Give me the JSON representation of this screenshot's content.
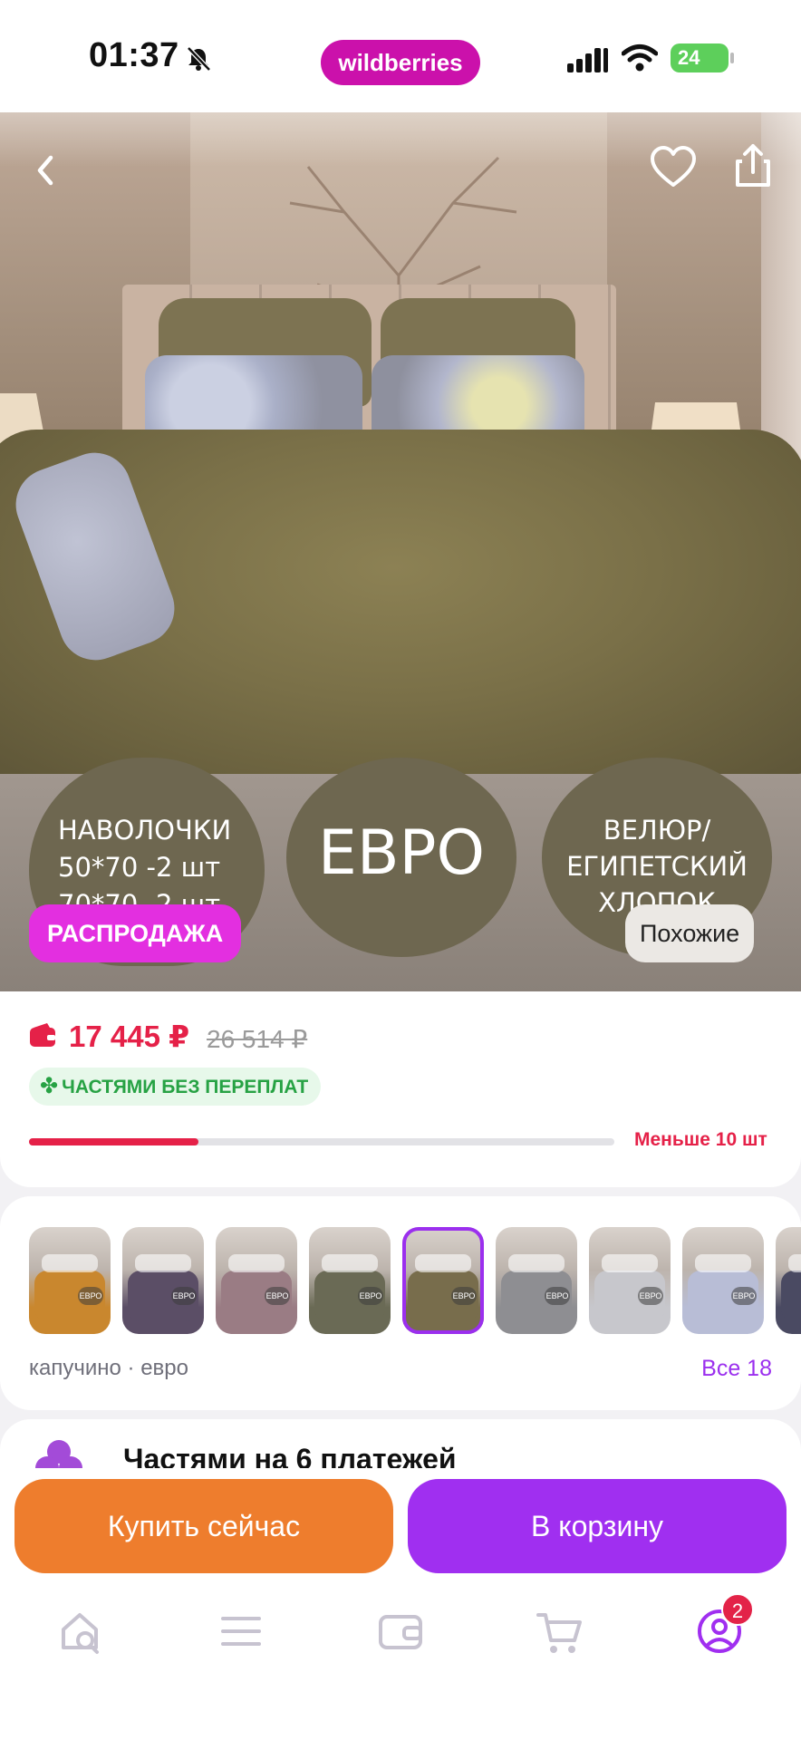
{
  "status_bar": {
    "time": "01:37",
    "battery": "24"
  },
  "brand": {
    "logo_text": "wildberries",
    "accent": "#cb11ab"
  },
  "hero": {
    "back_icon": "chevron-left-icon",
    "favorite_icon": "heart-icon",
    "share_icon": "share-icon",
    "badges": {
      "pillowcases_line1": "НАВОЛОЧКИ",
      "pillowcases_line2": "50*70 -2 шт",
      "pillowcases_line3": "70*70 -2 шт",
      "size": "ЕВРО",
      "material_line1": "ВЕЛЮР/",
      "material_line2": "ЕГИПЕТСКИЙ",
      "material_line3": "ХЛОПОК"
    },
    "sale_label": "РАСПРОДАЖА",
    "similar_label": "Похожие"
  },
  "price": {
    "current": "17 445 ₽",
    "old": "26 514 ₽",
    "installment_label": "ЧАСТЯМИ БЕЗ ПЕРЕПЛАТ",
    "stock_text": "Меньше 10 шт",
    "stock_fraction": 0.29,
    "price_color": "#e52148"
  },
  "variants": {
    "selected_label": "капучино · евро",
    "all_link": "Все 18",
    "thumbs": [
      {
        "color": "#c9872e",
        "tag": "ЕВРО"
      },
      {
        "color": "#5b4e66",
        "tag": "ЕВРО"
      },
      {
        "color": "#9a7c84",
        "tag": "ЕВРО"
      },
      {
        "color": "#6a6a55",
        "tag": "ЕВРО"
      },
      {
        "color": "#786d4c",
        "tag": "ЕВРО",
        "selected": true
      },
      {
        "color": "#8e8e92",
        "tag": "ЕВРО"
      },
      {
        "color": "#c7c7cc",
        "tag": "ЕВРО"
      },
      {
        "color": "#b8bdd6",
        "tag": "ЕВРО"
      },
      {
        "color": "#4a4a62",
        "tag": ""
      }
    ],
    "selected_color": "#9b2fee"
  },
  "installment_plan": {
    "title": "Частями на 6 платежей"
  },
  "actions": {
    "buy_now": "Купить сейчас",
    "add_to_cart": "В корзину",
    "buy_color": "#ee7d2d",
    "cart_color": "#a02ff0"
  },
  "tabbar": {
    "items": [
      "home-search-icon",
      "catalog-menu-icon",
      "wallet-icon",
      "cart-icon",
      "profile-icon"
    ],
    "profile_badge": "2"
  }
}
